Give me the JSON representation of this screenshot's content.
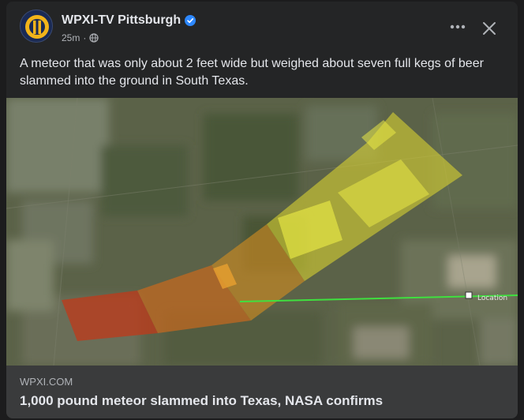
{
  "post": {
    "page_name": "WPXI-TV Pittsburgh",
    "timestamp": "25m",
    "visibility_icon": "globe-icon",
    "verified_icon": "verified-badge-icon",
    "text": "A meteor that was only about 2 feet wide but weighed about seven full kegs of beer slammed into the ground in South Texas."
  },
  "map": {
    "location_label": "Location"
  },
  "link_preview": {
    "domain": "WPXI.COM",
    "title": "1,000 pound meteor slammed into Texas, NASA confirms"
  },
  "colors": {
    "card_bg": "#242526",
    "link_bg": "#3a3b3c",
    "verified": "#2d88ff",
    "text_primary": "#e4e6eb",
    "text_secondary": "#b0b3b8"
  }
}
